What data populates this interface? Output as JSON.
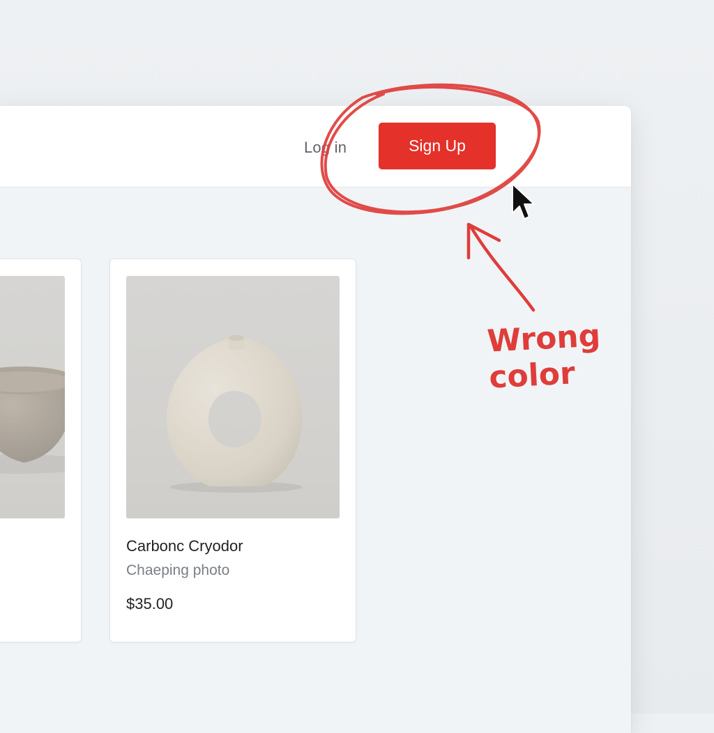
{
  "header": {
    "login_label": "Log in",
    "signup_label": "Sign Up"
  },
  "products": [
    {
      "title": "",
      "subtitle": "",
      "price": "",
      "image": "bowl-photo"
    },
    {
      "title": "Carbonc Cryodor",
      "subtitle": "Chaeping photo",
      "price": "$35.00",
      "image": "donut-vase-photo"
    }
  ],
  "annotation": {
    "text": "Wrong color",
    "color": "#df3d3a"
  },
  "colors": {
    "signup_button": "#e4312a",
    "annotation": "#df3d3a"
  }
}
